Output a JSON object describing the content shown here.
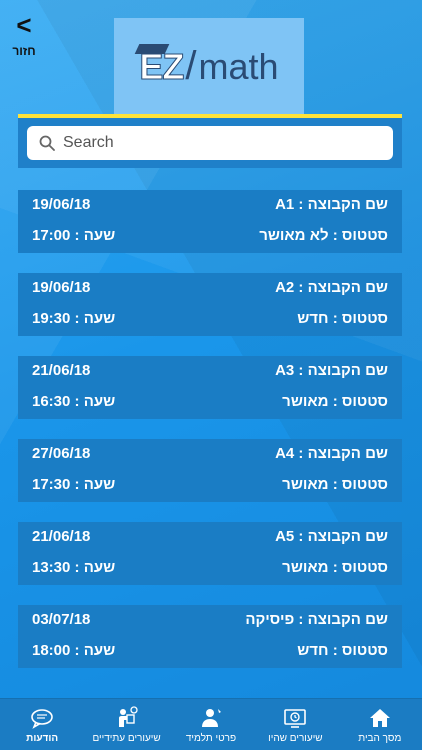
{
  "header": {
    "back_label": "חזור",
    "logo_text_ez": "EZ",
    "logo_text_math": "math"
  },
  "search": {
    "placeholder": "Search",
    "value": ""
  },
  "labels": {
    "group_prefix": "שם הקבוצה : ",
    "status_prefix": "סטטוס : ",
    "time_prefix": "שעה : "
  },
  "lessons": [
    {
      "group": "A1",
      "date": "19/06/18",
      "status": "לא מאושר",
      "time": "17:00"
    },
    {
      "group": "A2",
      "date": "19/06/18",
      "status": "חדש",
      "time": "19:30"
    },
    {
      "group": "A3",
      "date": "21/06/18",
      "status": "מאושר",
      "time": "16:30"
    },
    {
      "group": "A4",
      "date": "27/06/18",
      "status": "מאושר",
      "time": "17:30"
    },
    {
      "group": "A5",
      "date": "21/06/18",
      "status": "מאושר",
      "time": "13:30"
    },
    {
      "group": "פיסיקה",
      "date": "03/07/18",
      "status": "חדש",
      "time": "18:00"
    }
  ],
  "tabs": [
    {
      "label": "מסך הבית",
      "icon": "home-icon"
    },
    {
      "label": "שיעורים שהיו",
      "icon": "past-lessons-icon"
    },
    {
      "label": "פרטי תלמיד",
      "icon": "student-icon"
    },
    {
      "label": "שיעורים עתידיים",
      "icon": "future-lessons-icon"
    },
    {
      "label": "הודעות",
      "icon": "messages-icon"
    }
  ],
  "colors": {
    "background": "#1a96ea",
    "card": "#1a7dc5",
    "accent_bar": "#ffe33a",
    "tabbar": "#1b7cc3"
  }
}
